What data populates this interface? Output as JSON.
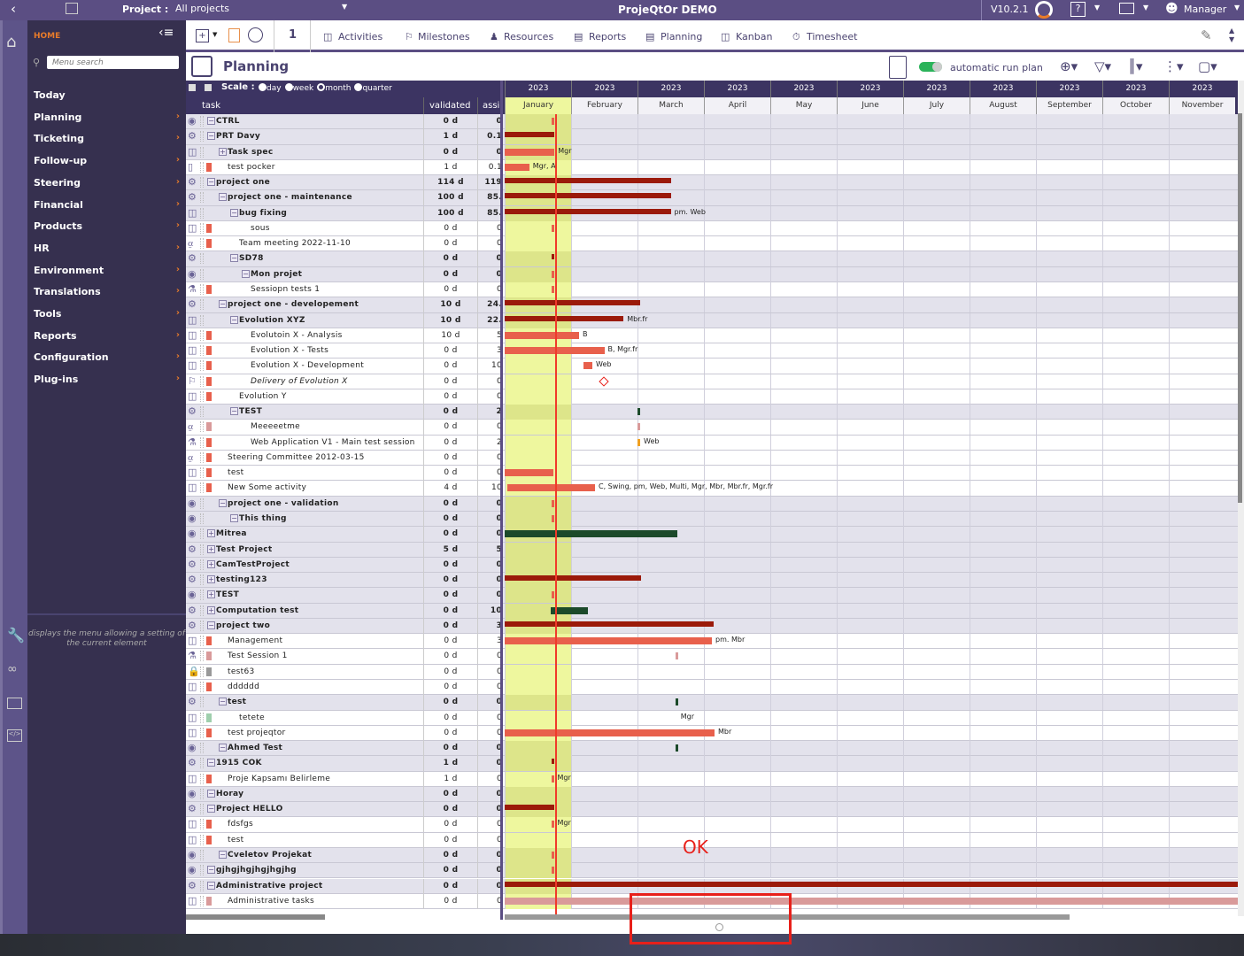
{
  "topbar": {
    "project_label": "Project :",
    "project_value": "All projects",
    "app_title": "ProjeQtOr DEMO",
    "version": "V10.2.1",
    "help": "?",
    "user": "Manager"
  },
  "sidebar": {
    "home": "HOME",
    "search_placeholder": "Menu search",
    "items": [
      {
        "label": "Today",
        "arrow": false
      },
      {
        "label": "Planning",
        "arrow": true
      },
      {
        "label": "Ticketing",
        "arrow": true
      },
      {
        "label": "Follow-up",
        "arrow": true
      },
      {
        "label": "Steering",
        "arrow": true
      },
      {
        "label": "Financial",
        "arrow": true
      },
      {
        "label": "Products",
        "arrow": true
      },
      {
        "label": "HR",
        "arrow": true
      },
      {
        "label": "Environment",
        "arrow": true
      },
      {
        "label": "Translations",
        "arrow": true
      },
      {
        "label": "Tools",
        "arrow": true
      },
      {
        "label": "Reports",
        "arrow": true
      },
      {
        "label": "Configuration",
        "arrow": true
      },
      {
        "label": "Plug-ins",
        "arrow": true
      }
    ],
    "tooltip": "displays the menu allowing a setting of the current element"
  },
  "toolbar": {
    "count": "1",
    "items": [
      "Activities",
      "Milestones",
      "Resources",
      "Reports",
      "Planning",
      "Kanban",
      "Timesheet"
    ]
  },
  "planning": {
    "title": "Planning",
    "auto_run": "automatic run plan",
    "auto_run_on": true,
    "scale_label": "Scale :",
    "scales": [
      "day",
      "week",
      "month",
      "quarter"
    ],
    "scale_selected": "month"
  },
  "columns": {
    "task": "task",
    "validated": "validated",
    "assigned": "assig"
  },
  "months": [
    {
      "y": "2023",
      "m": "January"
    },
    {
      "y": "2023",
      "m": "February"
    },
    {
      "y": "2023",
      "m": "March"
    },
    {
      "y": "2023",
      "m": "April"
    },
    {
      "y": "2023",
      "m": "May"
    },
    {
      "y": "2023",
      "m": "June"
    },
    {
      "y": "2023",
      "m": "July"
    },
    {
      "y": "2023",
      "m": "August"
    },
    {
      "y": "2023",
      "m": "September"
    },
    {
      "y": "2023",
      "m": "October"
    },
    {
      "y": "2023",
      "m": "November"
    }
  ],
  "today_month": 0.77,
  "colors": {
    "dark": "#9b1a0a",
    "red": "#e8604c",
    "pink": "#d99a9a",
    "green": "#1c4a2a",
    "orange": "#f0a020",
    "grey": "#999999",
    "mint": "#9fcfad"
  },
  "rows": [
    {
      "n": "CTRL",
      "l": 0,
      "g": 1,
      "e": "-",
      "ic": "gear-dot",
      "v": "0 d",
      "a": "0",
      "b": [
        [
          0.7,
          0.73,
          "red"
        ]
      ]
    },
    {
      "n": "PRT Davy",
      "l": 0,
      "g": 1,
      "e": "-",
      "ic": "gear",
      "v": "1 d",
      "a": "0.1",
      "b": [
        [
          0,
          0.75,
          "dark"
        ]
      ]
    },
    {
      "n": "Task spec",
      "l": 1,
      "g": 1,
      "e": "+",
      "ic": "activity",
      "v": "0 d",
      "a": "0",
      "b": [
        [
          0,
          0.75,
          "red"
        ]
      ],
      "t": "Mgr"
    },
    {
      "n": "test pocker",
      "l": 1,
      "ic": "ticket",
      "c": "red",
      "v": "1 d",
      "a": "0.1",
      "b": [
        [
          0,
          0.37,
          "red"
        ]
      ],
      "t": "Mgr, A"
    },
    {
      "n": "project one",
      "l": 0,
      "g": 1,
      "e": "-",
      "ic": "gear",
      "v": "114 d",
      "a": "119",
      "b": [
        [
          0,
          2.51,
          "dark"
        ]
      ]
    },
    {
      "n": "project one - maintenance",
      "l": 1,
      "g": 1,
      "e": "-",
      "ic": "gear",
      "v": "100 d",
      "a": "85.",
      "b": [
        [
          0,
          2.5,
          "dark"
        ]
      ]
    },
    {
      "n": "bug fixing",
      "l": 2,
      "g": 1,
      "e": "-",
      "ic": "activity",
      "v": "100 d",
      "a": "85.",
      "b": [
        [
          0,
          2.5,
          "dark"
        ]
      ],
      "t": "pm. Web"
    },
    {
      "n": "sous",
      "l": 3,
      "ic": "activity",
      "c": "red",
      "v": "0 d",
      "a": "0",
      "b": [
        [
          0.7,
          0.73,
          "red"
        ]
      ]
    },
    {
      "n": "Team meeting 2022-11-10",
      "l": 2,
      "ic": "meeting",
      "c": "red",
      "v": "0 d",
      "a": "0",
      "b": []
    },
    {
      "n": "SD78",
      "l": 2,
      "g": 1,
      "e": "-",
      "ic": "gear",
      "v": "0 d",
      "a": "0",
      "b": [
        [
          0.7,
          0.73,
          "dark"
        ]
      ]
    },
    {
      "n": "Mon projet",
      "l": 3,
      "g": 1,
      "e": "-",
      "ic": "gear-dot",
      "v": "0 d",
      "a": "0",
      "b": [
        [
          0.7,
          0.73,
          "red"
        ]
      ]
    },
    {
      "n": "Sessiopn tests 1",
      "l": 3,
      "ic": "test",
      "c": "red",
      "v": "0 d",
      "a": "0",
      "b": [
        [
          0.7,
          0.73,
          "red"
        ]
      ]
    },
    {
      "n": "project one - developement",
      "l": 1,
      "g": 1,
      "e": "-",
      "ic": "gear",
      "v": "10 d",
      "a": "24.",
      "b": [
        [
          0,
          2.04,
          "dark"
        ]
      ]
    },
    {
      "n": "Evolution XYZ",
      "l": 2,
      "g": 1,
      "e": "-",
      "ic": "activity",
      "v": "10 d",
      "a": "22.",
      "b": [
        [
          0,
          1.79,
          "dark"
        ]
      ],
      "t": "Mbr.fr"
    },
    {
      "n": "Evolutoin X - Analysis",
      "l": 3,
      "ic": "activity",
      "c": "red",
      "v": "10 d",
      "a": "5",
      "b": [
        [
          0,
          1.12,
          "red"
        ]
      ],
      "t": "B"
    },
    {
      "n": "Evolution X - Tests",
      "l": 3,
      "ic": "activity",
      "c": "red",
      "v": "0 d",
      "a": "3",
      "b": [
        [
          0,
          1.5,
          "red"
        ]
      ],
      "t": "B, Mgr.fr"
    },
    {
      "n": "Evolution X - Development",
      "l": 3,
      "ic": "activity",
      "c": "red",
      "v": "0 d",
      "a": "10",
      "b": [
        [
          1.19,
          1.32,
          "red"
        ]
      ],
      "t": "Web"
    },
    {
      "n": "Delivery of Evolution X",
      "l": 3,
      "ic": "milestone",
      "c": "red",
      "it": 1,
      "v": "0 d",
      "a": "0",
      "b": [
        [
          1.44,
          1.52,
          "milestone"
        ]
      ]
    },
    {
      "n": "Evolution Y",
      "l": 2,
      "ic": "activity",
      "c": "red",
      "v": "0 d",
      "a": "0",
      "b": []
    },
    {
      "n": "TEST",
      "l": 2,
      "g": 1,
      "e": "-",
      "ic": "gear",
      "v": "0 d",
      "a": "2",
      "b": [
        [
          2.0,
          2.03,
          "green"
        ]
      ]
    },
    {
      "n": "Meeeeetme",
      "l": 3,
      "ic": "meeting",
      "c": "pink",
      "v": "0 d",
      "a": "0",
      "b": [
        [
          2.0,
          2.03,
          "pink"
        ]
      ]
    },
    {
      "n": "Web Application V1 - Main test session",
      "l": 3,
      "ic": "test",
      "c": "red",
      "v": "0 d",
      "a": "2",
      "b": [
        [
          2.0,
          2.03,
          "orange"
        ]
      ],
      "t": "Web"
    },
    {
      "n": "Steering Committee 2012-03-15",
      "l": 1,
      "ic": "meeting",
      "c": "red",
      "v": "0 d",
      "a": "0",
      "b": []
    },
    {
      "n": "test",
      "l": 1,
      "ic": "activity",
      "c": "red",
      "v": "0 d",
      "a": "0",
      "b": [
        [
          0,
          0.73,
          "red"
        ]
      ]
    },
    {
      "n": "New Some activity",
      "l": 1,
      "ic": "activity",
      "c": "red",
      "v": "4 d",
      "a": "10",
      "b": [
        [
          0.04,
          1.36,
          "red"
        ]
      ],
      "t": "C, Swing, pm, Web, Multi, Mgr, Mbr, Mbr.fr, Mgr.fr"
    },
    {
      "n": "project one - validation",
      "l": 1,
      "g": 1,
      "e": "-",
      "ic": "gear-dot",
      "v": "0 d",
      "a": "0",
      "b": [
        [
          0.7,
          0.73,
          "red"
        ]
      ]
    },
    {
      "n": "This thing",
      "l": 2,
      "g": 1,
      "e": "-",
      "ic": "gear-dot",
      "v": "0 d",
      "a": "0",
      "b": [
        [
          0.7,
          0.73,
          "red"
        ]
      ]
    },
    {
      "n": "Mitrea",
      "l": 0,
      "g": 1,
      "e": "+",
      "ic": "gear-dot",
      "v": "0 d",
      "a": "0",
      "b": [
        [
          0,
          2.6,
          "green"
        ]
      ]
    },
    {
      "n": "Test Project",
      "l": 0,
      "g": 1,
      "e": "+",
      "ic": "gear",
      "v": "5 d",
      "a": "5",
      "b": []
    },
    {
      "n": "CamTestProject",
      "l": 0,
      "g": 1,
      "e": "+",
      "ic": "gear",
      "v": "0 d",
      "a": "0",
      "b": []
    },
    {
      "n": "testing123",
      "l": 0,
      "g": 1,
      "e": "+",
      "ic": "gear",
      "v": "0 d",
      "a": "0",
      "b": [
        [
          0,
          2.05,
          "dark"
        ]
      ]
    },
    {
      "n": "TEST",
      "l": 0,
      "g": 1,
      "e": "+",
      "ic": "gear-dot",
      "v": "0 d",
      "a": "0",
      "b": [
        [
          0.7,
          0.73,
          "red"
        ]
      ]
    },
    {
      "n": "Computation test",
      "l": 0,
      "g": 1,
      "e": "+",
      "ic": "gear",
      "v": "0 d",
      "a": "10",
      "b": [
        [
          0.69,
          1.25,
          "green"
        ]
      ]
    },
    {
      "n": "project two",
      "l": 0,
      "g": 1,
      "e": "-",
      "ic": "gear",
      "v": "0 d",
      "a": "3",
      "b": [
        [
          0,
          3.15,
          "dark"
        ]
      ]
    },
    {
      "n": "Management",
      "l": 1,
      "ic": "activity",
      "c": "red",
      "v": "0 d",
      "a": "3",
      "b": [
        [
          0,
          3.12,
          "red"
        ]
      ],
      "t": "pm. Mbr"
    },
    {
      "n": "Test Session 1",
      "l": 1,
      "ic": "test",
      "c": "pink",
      "v": "0 d",
      "a": "0",
      "b": [
        [
          2.57,
          2.6,
          "pink"
        ]
      ]
    },
    {
      "n": "test63",
      "l": 1,
      "ic": "lock",
      "c": "grey",
      "v": "0 d",
      "a": "0",
      "b": []
    },
    {
      "n": "dddddd",
      "l": 1,
      "ic": "activity",
      "c": "red",
      "v": "0 d",
      "a": "0",
      "b": []
    },
    {
      "n": "test",
      "l": 1,
      "g": 1,
      "e": "-",
      "ic": "gear",
      "v": "0 d",
      "a": "0",
      "b": [
        [
          2.57,
          2.6,
          "green"
        ]
      ]
    },
    {
      "n": "tetete",
      "l": 2,
      "ic": "activity",
      "c": "mint",
      "v": "0 d",
      "a": "0",
      "b": [],
      "t": "Mgr",
      "tx": 2.65
    },
    {
      "n": "test projeqtor",
      "l": 1,
      "ic": "activity",
      "c": "red",
      "v": "0 d",
      "a": "0",
      "b": [
        [
          0,
          3.16,
          "red"
        ]
      ],
      "t": "Mbr"
    },
    {
      "n": "Ahmed Test",
      "l": 1,
      "g": 1,
      "e": "-",
      "ic": "gear-dot",
      "v": "0 d",
      "a": "0",
      "b": [
        [
          2.57,
          2.6,
          "green"
        ]
      ]
    },
    {
      "n": "1915 COK",
      "l": 0,
      "g": 1,
      "e": "-",
      "ic": "gear",
      "v": "1 d",
      "a": "0",
      "b": [
        [
          0.7,
          0.73,
          "dark"
        ]
      ]
    },
    {
      "n": "Proje Kapsamı Belirleme",
      "l": 1,
      "ic": "activity",
      "c": "red",
      "v": "1 d",
      "a": "0",
      "b": [
        [
          0.7,
          0.73,
          "red"
        ]
      ],
      "t": "Mgr"
    },
    {
      "n": "Horay",
      "l": 0,
      "g": 1,
      "e": "-",
      "ic": "gear-dot",
      "v": "0 d",
      "a": "0",
      "b": []
    },
    {
      "n": "Project HELLO",
      "l": 0,
      "g": 1,
      "e": "-",
      "ic": "gear",
      "v": "0 d",
      "a": "0",
      "b": [
        [
          0,
          0.75,
          "dark"
        ]
      ]
    },
    {
      "n": "fdsfgs",
      "l": 1,
      "ic": "activity",
      "c": "red",
      "v": "0 d",
      "a": "0",
      "b": [
        [
          0.7,
          0.73,
          "red"
        ]
      ],
      "t": "Mgr"
    },
    {
      "n": "test",
      "l": 1,
      "ic": "activity",
      "c": "red",
      "v": "0 d",
      "a": "0",
      "b": []
    },
    {
      "n": "Cveletov Projekat",
      "l": 1,
      "g": 1,
      "e": "-",
      "ic": "gear-dot",
      "v": "0 d",
      "a": "0",
      "b": [
        [
          0.7,
          0.73,
          "red"
        ]
      ]
    },
    {
      "n": "gjhgjhgjhgjhgjhg",
      "l": 0,
      "g": 1,
      "e": "-",
      "ic": "gear-dot",
      "v": "0 d",
      "a": "0",
      "b": [
        [
          0.7,
          0.73,
          "red"
        ]
      ]
    },
    {
      "n": "Administrative project",
      "l": 0,
      "g": 1,
      "e": "-",
      "ic": "gear",
      "v": "0 d",
      "a": "0",
      "b": [
        [
          0,
          11.1,
          "dark"
        ]
      ]
    },
    {
      "n": "Administrative tasks",
      "l": 1,
      "ic": "activity",
      "c": "pink",
      "v": "0 d",
      "a": "0",
      "b": [
        [
          0,
          11.1,
          "pink"
        ]
      ]
    }
  ],
  "annotation": {
    "text": "OK"
  }
}
